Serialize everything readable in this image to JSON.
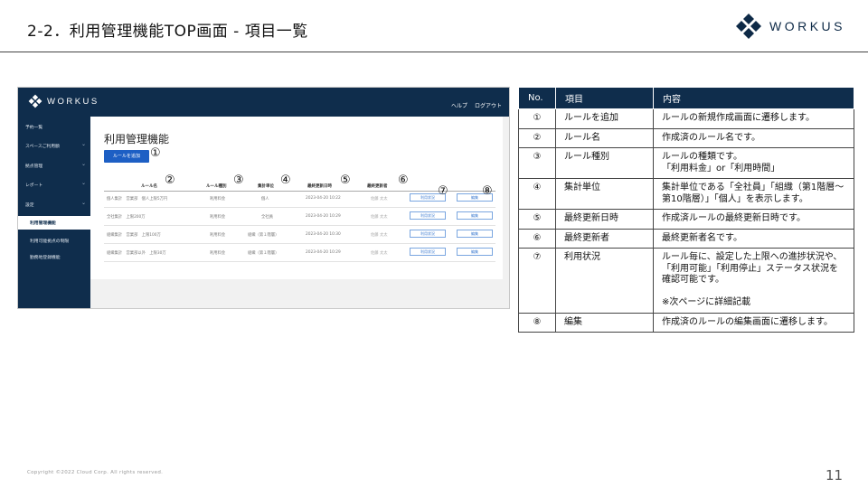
{
  "slide": {
    "title": "2-2．利用管理機能TOP画面 - 項目一覧",
    "brand": "WORKUS",
    "copyright": "Copyright ©2022 Cloud Corp. All rights reserved.",
    "page_number": "11"
  },
  "screen": {
    "brand": "WORKUS",
    "top_links": [
      "ヘルプ",
      "ログアウト"
    ],
    "sidebar": [
      {
        "label": "予約一覧"
      },
      {
        "label": "スペースご利用額"
      },
      {
        "label": "拠点管理"
      },
      {
        "label": "レポート"
      },
      {
        "label": "設定"
      },
      {
        "label": "利用管理機能"
      },
      {
        "label": "利用可能拠点の制限"
      },
      {
        "label": "勤務地登録機能"
      }
    ],
    "page_title": "利用管理機能",
    "add_button": "ルールを追加",
    "columns": [
      "ルール名",
      "ルール種別",
      "集計単位",
      "最終更新日時",
      "最終更新者"
    ],
    "rows": [
      {
        "name": "個人集計　営業部　個人上限5万円",
        "type": "利用料金",
        "unit": "個人",
        "updated": "2023-04-20 10:22",
        "by": "佐藤 太太",
        "status": "利用状況",
        "edit": "編集"
      },
      {
        "name": "全社集計　上限200万",
        "type": "利用料金",
        "unit": "全社員",
        "updated": "2023-04-20 10:29",
        "by": "佐藤 太太",
        "status": "利用状況",
        "edit": "編集"
      },
      {
        "name": "組織集計　営業部　上限100万",
        "type": "利用料金",
        "unit": "組織（第１階層）",
        "updated": "2023-04-20 10:30",
        "by": "佐藤 太太",
        "status": "利用状況",
        "edit": "編集"
      },
      {
        "name": "組織集計　営業部以外　上限30万",
        "type": "利用料金",
        "unit": "組織（第１階層）",
        "updated": "2023-04-20 10:29",
        "by": "佐藤 太太",
        "status": "利用状況",
        "edit": "編集"
      }
    ],
    "markers": [
      "①",
      "②",
      "③",
      "④",
      "⑤",
      "⑥",
      "⑦",
      "⑧"
    ]
  },
  "spec_table": {
    "headers": [
      "No.",
      "項目",
      "内容"
    ],
    "rows": [
      {
        "no": "①",
        "item": "ルールを追加",
        "desc": "ルールの新規作成画面に遷移します。"
      },
      {
        "no": "②",
        "item": "ルール名",
        "desc": "作成済のルール名です。"
      },
      {
        "no": "③",
        "item": "ルール種別",
        "desc": "ルールの種類です。\n「利用料金」or「利用時間」"
      },
      {
        "no": "④",
        "item": "集計単位",
        "desc": "集計単位である「全社員」「組織（第1階層～第10階層）」「個人」を表示します。"
      },
      {
        "no": "⑤",
        "item": "最終更新日時",
        "desc": "作成済ルールの最終更新日時です。"
      },
      {
        "no": "⑥",
        "item": "最終更新者",
        "desc": "最終更新者名です。"
      },
      {
        "no": "⑦",
        "item": "利用状況",
        "desc": "ルール毎に、設定した上限への進捗状況や、「利用可能」「利用停止」ステータス状況を確認可能です。\n\n※次ページに詳細記載"
      },
      {
        "no": "⑧",
        "item": "編集",
        "desc": "作成済のルールの編集画面に遷移します。"
      }
    ]
  },
  "colors": {
    "navy": "#0f2d4c",
    "accent_blue": "#1d5fc4"
  }
}
